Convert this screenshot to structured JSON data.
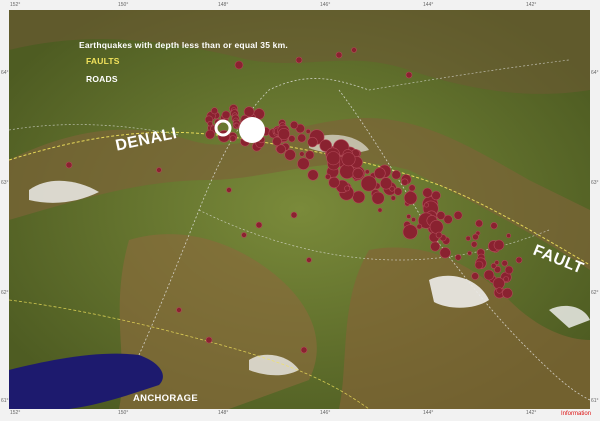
{
  "legend": {
    "title": "Earthquakes with depth less than or equal 35 km.",
    "faults": "FAULTS",
    "roads": "ROADS"
  },
  "labels": {
    "city": "ANCHORAGE",
    "fault_part1": "DENALI",
    "fault_part2": "FAULT"
  },
  "footer": {
    "info": "Information"
  },
  "ticks": {
    "top": [
      "152°",
      "150°",
      "148°",
      "146°",
      "144°",
      "142°"
    ],
    "bottom": [
      "152°",
      "150°",
      "148°",
      "146°",
      "144°",
      "142°"
    ],
    "left": [
      "64°",
      "63°",
      "62°",
      "61°"
    ],
    "right": [
      "64°",
      "63°",
      "62°",
      "61°"
    ]
  },
  "colors": {
    "earthquake": "#8a2230",
    "earthquake_edge": "#b24a58",
    "mainshock": "#ffffff",
    "faults": "#f2e35c",
    "roads": "#e8e8e8",
    "water": "#1d1a6e",
    "lowland": "#6b7a34",
    "mountain": "#8a6a3c",
    "snow": "#f5f5f5"
  }
}
